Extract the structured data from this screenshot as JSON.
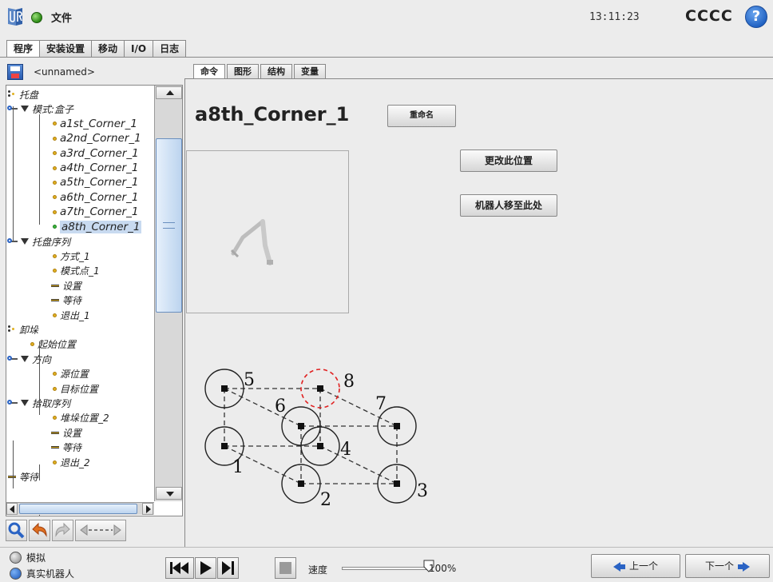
{
  "titlebar": {
    "file_menu": "文件",
    "clock": "13:11:23",
    "robot_name": "CCCC",
    "help": "?"
  },
  "main_tabs": [
    "程序",
    "安装设置",
    "移动",
    "I/O",
    "日志"
  ],
  "program": {
    "name": "<unnamed>"
  },
  "tree": {
    "items": [
      {
        "label": "托盘",
        "icon": "palette-icon"
      },
      {
        "label": "模式:盒子",
        "icon": "expand-triangle-icon"
      },
      {
        "label": "a1st_Corner_1",
        "icon": "waypoint-icon"
      },
      {
        "label": "a2nd_Corner_1",
        "icon": "waypoint-icon"
      },
      {
        "label": "a3rd_Corner_1",
        "icon": "waypoint-icon"
      },
      {
        "label": "a4th_Corner_1",
        "icon": "waypoint-icon"
      },
      {
        "label": "a5th_Corner_1",
        "icon": "waypoint-icon"
      },
      {
        "label": "a6th_Corner_1",
        "icon": "waypoint-icon"
      },
      {
        "label": "a7th_Corner_1",
        "icon": "waypoint-icon"
      },
      {
        "label": "a8th_Corner_1",
        "icon": "waypoint-icon"
      },
      {
        "label": "托盘序列",
        "icon": "expand-triangle-icon"
      },
      {
        "label": "方式_1",
        "icon": "waypoint-icon"
      },
      {
        "label": "模式点_1",
        "icon": "waypoint-icon"
      },
      {
        "label": "设置",
        "icon": "set-icon"
      },
      {
        "label": "等待",
        "icon": "wait-icon"
      },
      {
        "label": "退出_1",
        "icon": "waypoint-icon"
      },
      {
        "label": "卸垛",
        "icon": "palette-icon"
      },
      {
        "label": "起始位置",
        "icon": "waypoint-icon"
      },
      {
        "label": "方向",
        "icon": "expand-triangle-icon"
      },
      {
        "label": "源位置",
        "icon": "waypoint-icon"
      },
      {
        "label": "目标位置",
        "icon": "waypoint-icon"
      },
      {
        "label": "拾取序列",
        "icon": "expand-triangle-icon"
      },
      {
        "label": "堆垛位置_2",
        "icon": "waypoint-icon"
      },
      {
        "label": "设置",
        "icon": "set-icon"
      },
      {
        "label": "等待",
        "icon": "wait-icon"
      },
      {
        "label": "退出_2",
        "icon": "waypoint-icon"
      },
      {
        "label": "等待",
        "icon": "wait-icon"
      }
    ]
  },
  "sub_tabs": [
    "命令",
    "图形",
    "结构",
    "变量"
  ],
  "position": {
    "title": "a8th_Corner_1",
    "rename": "重命名",
    "change_position": "更改此位置",
    "move_robot_here": "机器人移至此处"
  },
  "pattern": {
    "labels": [
      "5",
      "8",
      "6",
      "7",
      "4",
      "1",
      "2",
      "3"
    ],
    "selected": "8"
  },
  "bottom": {
    "mode_simulate": "模拟",
    "mode_real": "真实机器人",
    "speed_label": "速度",
    "speed_value": "100%",
    "speed_fraction": 1.0,
    "prev": "上一个",
    "next": "下一个"
  },
  "colors": {
    "accent_blue": "#2a63c4",
    "selection": "#c8daf0",
    "highlight_red": "#e02020"
  }
}
